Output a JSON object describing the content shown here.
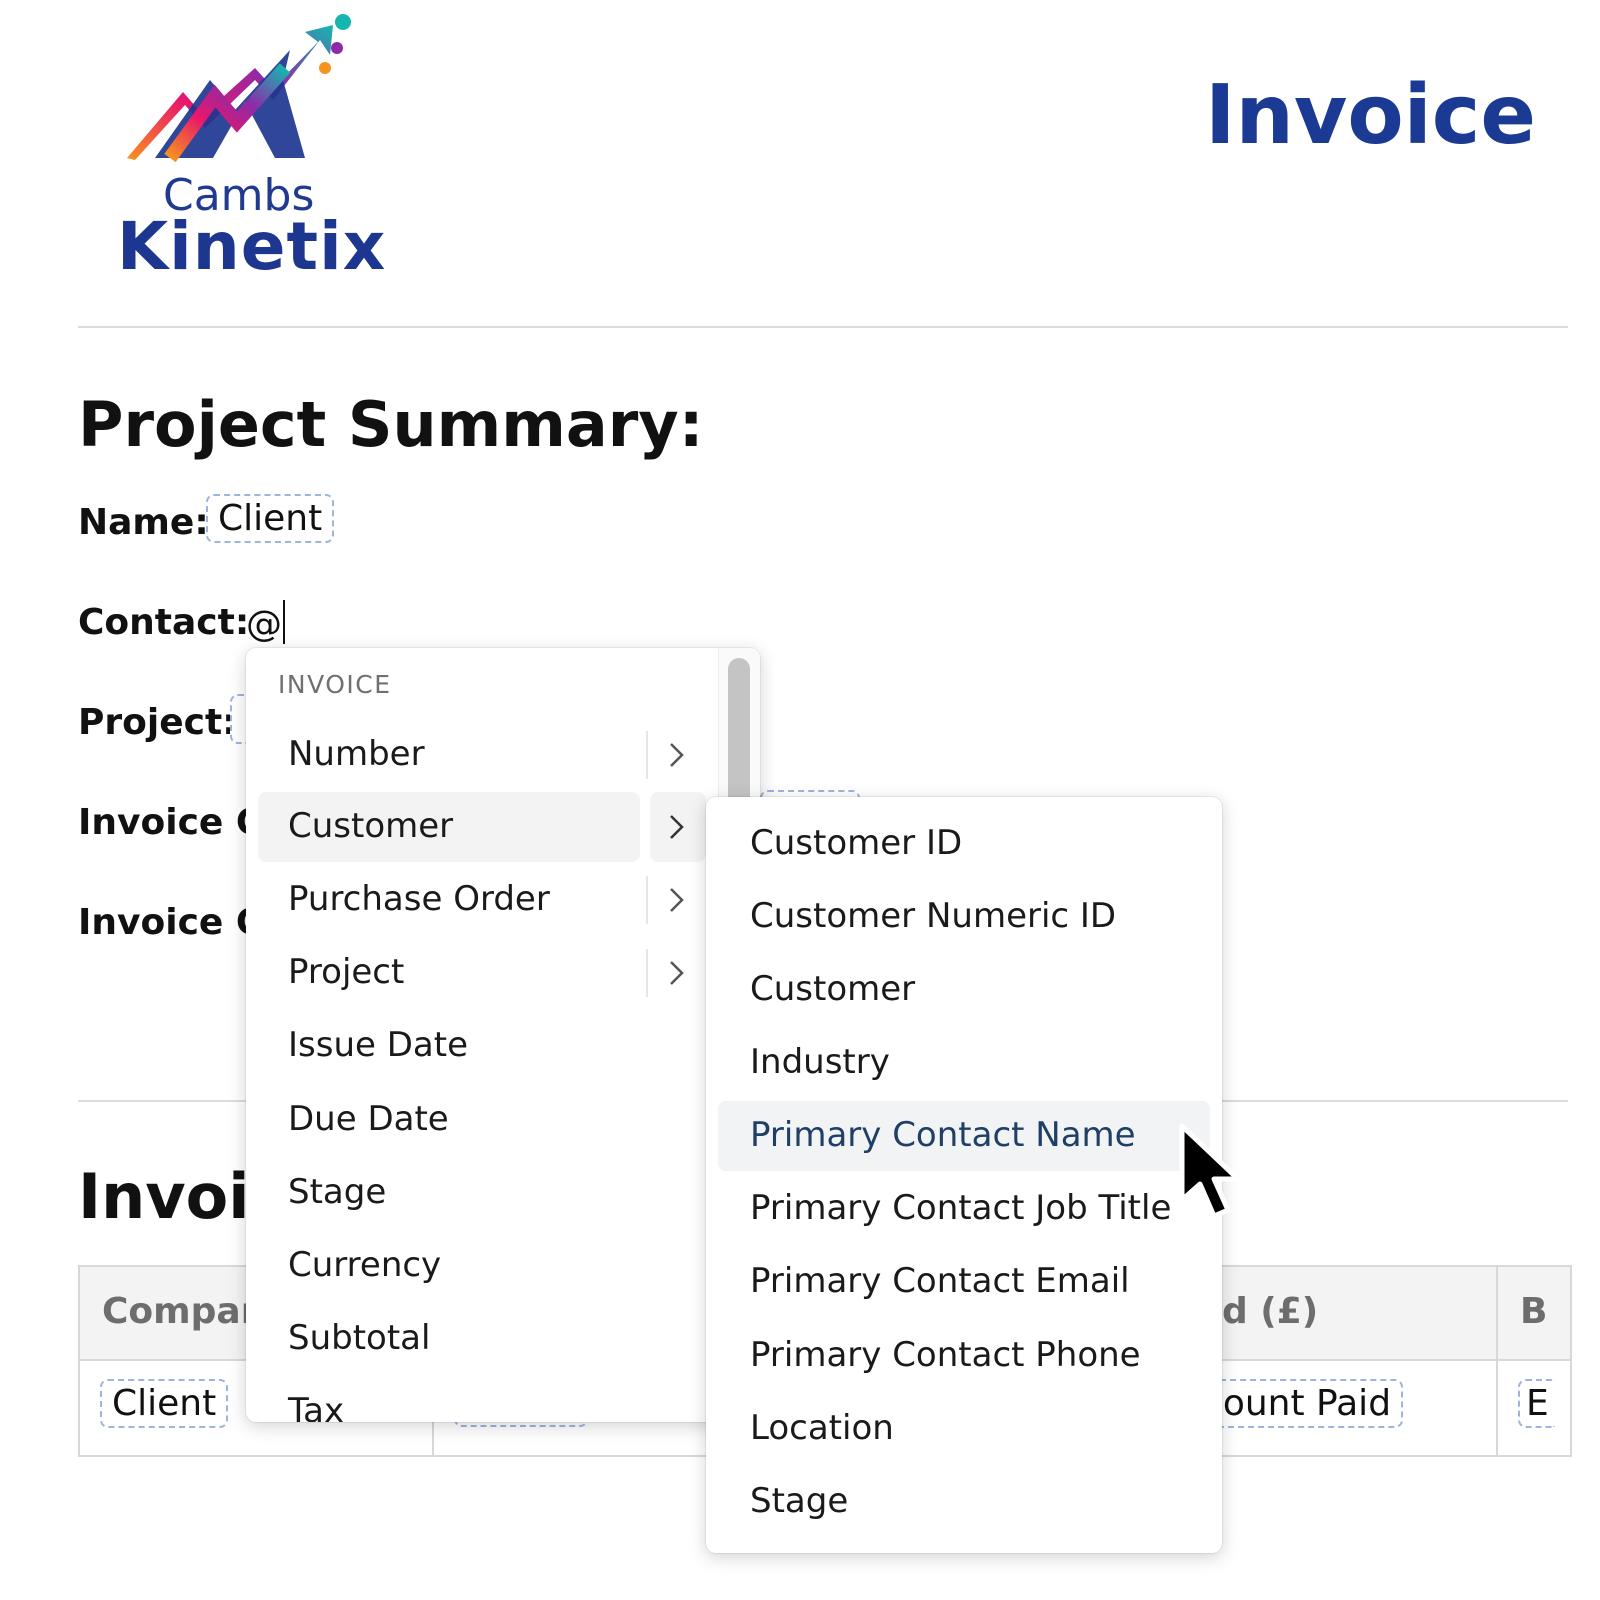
{
  "brand": {
    "logo_line1": "Cambs",
    "logo_line2": "Kinetix",
    "logo_icon": "rising-arrows-logo"
  },
  "document": {
    "title": "Invoice"
  },
  "summary": {
    "heading": "Project Summary:",
    "name_label": "Name:",
    "name_value": "Client",
    "contact_label": "Contact:",
    "contact_input": "@",
    "project_label": "Project:",
    "invoice_label_1": "Invoice C",
    "invoice_label_2": "Invoice C"
  },
  "section2": {
    "heading": "Invoic"
  },
  "table": {
    "headers": [
      "Compar",
      "d (£)",
      "B"
    ],
    "row": [
      "Client",
      "nount Paid",
      "E"
    ]
  },
  "menu": {
    "header": "INVOICE",
    "items": [
      {
        "label": "Number",
        "has_submenu": true
      },
      {
        "label": "Customer",
        "has_submenu": true,
        "active": true
      },
      {
        "label": "Purchase Order",
        "has_submenu": true
      },
      {
        "label": "Project",
        "has_submenu": true
      },
      {
        "label": "Issue Date",
        "has_submenu": false
      },
      {
        "label": "Due Date",
        "has_submenu": false
      },
      {
        "label": "Stage",
        "has_submenu": false
      },
      {
        "label": "Currency",
        "has_submenu": false
      },
      {
        "label": "Subtotal",
        "has_submenu": false
      },
      {
        "label": "Tax",
        "has_submenu": false
      }
    ]
  },
  "submenu": {
    "items": [
      {
        "label": "Customer ID"
      },
      {
        "label": "Customer Numeric ID"
      },
      {
        "label": "Customer"
      },
      {
        "label": "Industry"
      },
      {
        "label": "Primary Contact Name",
        "hover": true
      },
      {
        "label": "Primary Contact Job Title"
      },
      {
        "label": "Primary Contact Email"
      },
      {
        "label": "Primary Contact Phone"
      },
      {
        "label": "Location"
      },
      {
        "label": "Stage"
      }
    ]
  },
  "colors": {
    "brand_blue": "#1b3a93",
    "pill_border": "#9db4df",
    "menu_active_bg": "#f3f3f3",
    "hover_text": "#1f3f66"
  }
}
